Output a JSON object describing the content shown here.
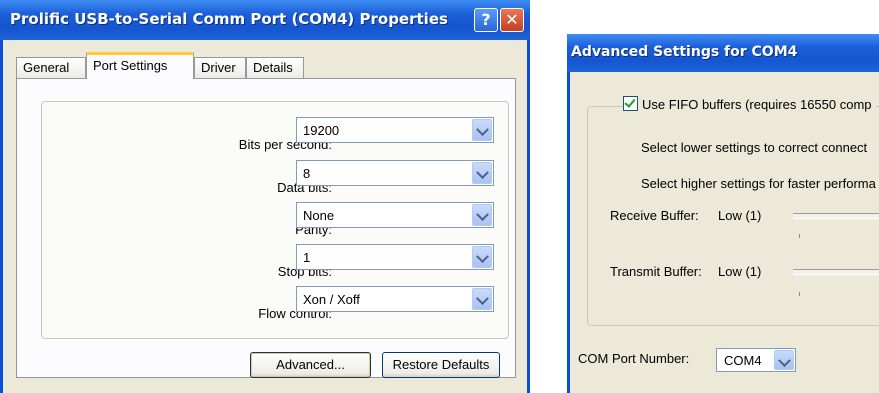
{
  "properties_dialog": {
    "title": "Prolific USB-to-Serial Comm Port (COM4) Properties",
    "help_glyph": "?",
    "close_glyph": "✕",
    "tabs": [
      {
        "label": "General",
        "active": false
      },
      {
        "label": "Port Settings",
        "active": true
      },
      {
        "label": "Driver",
        "active": false
      },
      {
        "label": "Details",
        "active": false
      }
    ],
    "fields": [
      {
        "label": "Bits per second:",
        "value": "19200"
      },
      {
        "label": "Data bits:",
        "value": "8"
      },
      {
        "label": "Parity:",
        "value": "None"
      },
      {
        "label": "Stop bits:",
        "value": "1"
      },
      {
        "label": "Flow control:",
        "value": "Xon / Xoff"
      }
    ],
    "advanced_button": "Advanced...",
    "restore_button": "Restore Defaults"
  },
  "advanced_dialog": {
    "title": "Advanced Settings for COM4",
    "fifo_label": "Use FIFO buffers (requires 16550 comp",
    "fifo_checked": true,
    "hint_lower": "Select lower settings to correct connect",
    "hint_higher": "Select higher settings for faster performa",
    "receive_label": "Receive Buffer:",
    "receive_value": "Low (1)",
    "transmit_label": "Transmit Buffer:",
    "transmit_value": "Low (1)",
    "com_port_label": "COM Port Number:",
    "com_port_value": "COM4"
  },
  "colors": {
    "titlebar": "#1555d0",
    "dialog_face": "#ece9d8",
    "tab_highlight": "#ffc83c",
    "close_button": "#c3401e"
  }
}
